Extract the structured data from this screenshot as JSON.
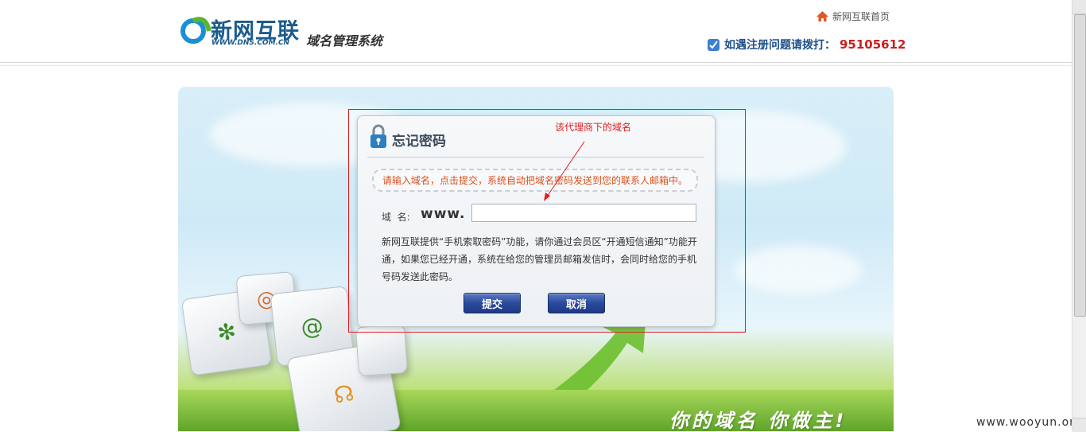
{
  "header": {
    "logo_cn": "新网互联",
    "logo_en": "WWW.DNS.COM.CN",
    "system_name": "域名管理系统",
    "home_link": "新网互联首页",
    "hotline_label": "如遇注册问题请拨打：",
    "hotline_number": "95105612"
  },
  "annotation": {
    "text": "该代理商下的域名",
    "color": "#e01c1c"
  },
  "dialog": {
    "title": "忘记密码",
    "notice": "请输入域名，点击提交，系统自动把域名密码发送到您的联系人邮箱中。",
    "domain_label": "域  名:",
    "www_prefix": "www.",
    "domain_value": "",
    "description": "新网互联提供“手机索取密码”功能，请你通过会员区“开通短信通知”功能开通，如果您已经开通，系统在给您的管理员邮箱发信时，会同时给您的手机号码发送此密码。",
    "submit_label": "提交",
    "cancel_label": "取消"
  },
  "banner": {
    "slogan": "你的域名  你做主!"
  },
  "watermark": "www.wooyun.org",
  "colors": {
    "brand": "#1b5b8c",
    "hotline_number": "#d01c1c",
    "notice_text": "#d9531e",
    "button": "#2b4a9c"
  }
}
